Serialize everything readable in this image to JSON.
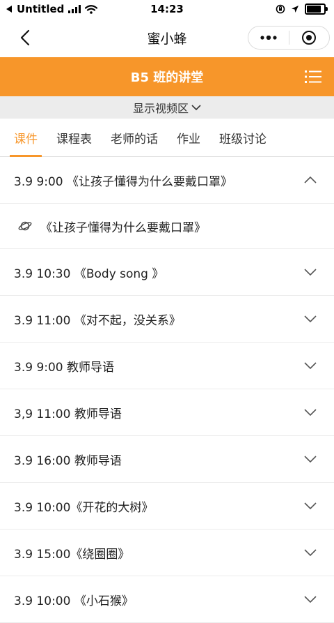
{
  "status": {
    "carrier": "Untitled",
    "time": "14:23"
  },
  "nav": {
    "title": "蜜小蜂"
  },
  "header": {
    "title": "B5 班的讲堂"
  },
  "video_toggle": {
    "label": "显示视频区"
  },
  "tabs": [
    {
      "label": "课件"
    },
    {
      "label": "课程表"
    },
    {
      "label": "老师的话"
    },
    {
      "label": "作业"
    },
    {
      "label": "班级讨论"
    }
  ],
  "colors": {
    "accent": "#f7962a",
    "bar_bg": "#ececec"
  },
  "lessons": [
    {
      "label": "3.9 9:00 《让孩子懂得为什么要戴口罩》",
      "expanded": true,
      "sub": "《让孩子懂得为什么要戴口罩》",
      "sub_icon": "planet-icon"
    },
    {
      "label": "3.9 10:30 《Body song 》"
    },
    {
      "label": "3.9 11:00 《对不起，没关系》"
    },
    {
      "label": "3.9 9:00 教师导语"
    },
    {
      "label": "3,9 11:00 教师导语"
    },
    {
      "label": "3.9 16:00 教师导语"
    },
    {
      "label": "3.9 10:00《开花的大树》"
    },
    {
      "label": "3.9 15:00《绕圈圈》"
    },
    {
      "label": "3.9 10:00 《小石猴》"
    }
  ]
}
